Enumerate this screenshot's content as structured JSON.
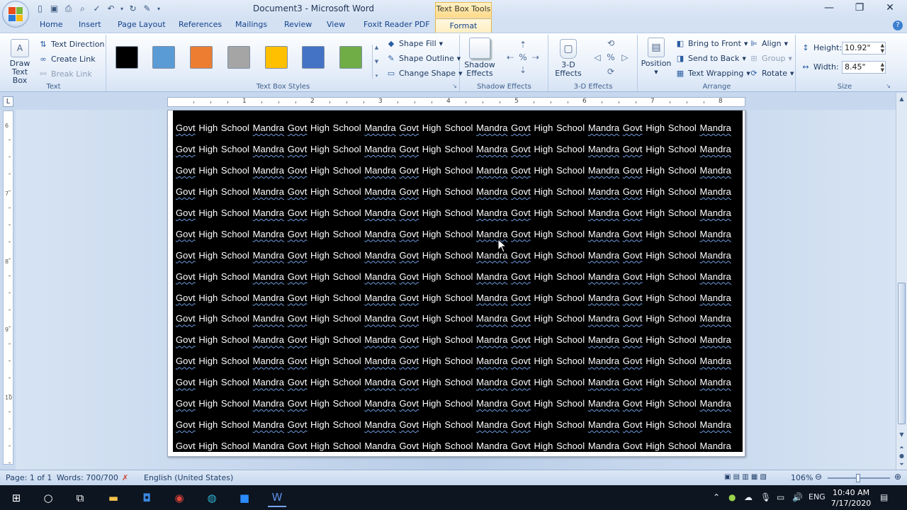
{
  "window": {
    "title": "Document3 - Microsoft Word",
    "context_tool": "Text Box Tools",
    "controls": {
      "minimize": "—",
      "restore": "❐",
      "close": "✕"
    }
  },
  "tabs": [
    "Home",
    "Insert",
    "Page Layout",
    "References",
    "Mailings",
    "Review",
    "View",
    "Foxit Reader PDF"
  ],
  "active_tab": "Format",
  "ribbon": {
    "text_group": {
      "label": "Text",
      "draw_text_box": "Draw\nText Box",
      "text_direction": "Text Direction",
      "create_link": "Create Link",
      "break_link": "Break Link"
    },
    "styles_group": {
      "label": "Text Box Styles",
      "swatches": [
        "#000000",
        "#5b9bd5",
        "#ed7d31",
        "#a5a5a5",
        "#ffc000",
        "#4472c4",
        "#70ad47"
      ],
      "shape_fill": "Shape Fill",
      "shape_outline": "Shape Outline",
      "change_shape": "Change Shape"
    },
    "shadow_group": {
      "label": "Shadow Effects",
      "button": "Shadow\nEffects"
    },
    "threed_group": {
      "label": "3-D Effects",
      "button": "3-D\nEffects"
    },
    "arrange_group": {
      "label": "Arrange",
      "position": "Position",
      "bring_to_front": "Bring to Front",
      "send_to_back": "Send to Back",
      "text_wrapping": "Text Wrapping",
      "align": "Align",
      "group": "Group",
      "rotate": "Rotate"
    },
    "size_group": {
      "label": "Size",
      "height_label": "Height:",
      "height_value": "10.92\"",
      "width_label": "Width:",
      "width_value": "8.45\""
    }
  },
  "ruler": {
    "h_numbers": [
      "1",
      "2",
      "3",
      "4",
      "5",
      "6",
      "7",
      "8"
    ],
    "v_numbers": [
      "6",
      "7",
      "8",
      "9",
      "10"
    ],
    "corner": "L"
  },
  "document": {
    "line_count": 16,
    "line_words": [
      "Govt",
      "High School",
      "Mandra",
      "Govt",
      "High School",
      "Mandra",
      "Govt",
      "High School",
      "Mandra",
      "Govt",
      "High School",
      "Mandra",
      "Govt",
      "High School",
      "Mandra"
    ]
  },
  "statusbar": {
    "page": "Page: 1 of 1",
    "words": "Words: 700/700",
    "language": "English (United States)",
    "zoom": "106%"
  },
  "taskbar": {
    "tray_lang": "ENG",
    "time": "10:40 AM",
    "date": "7/17/2020"
  }
}
